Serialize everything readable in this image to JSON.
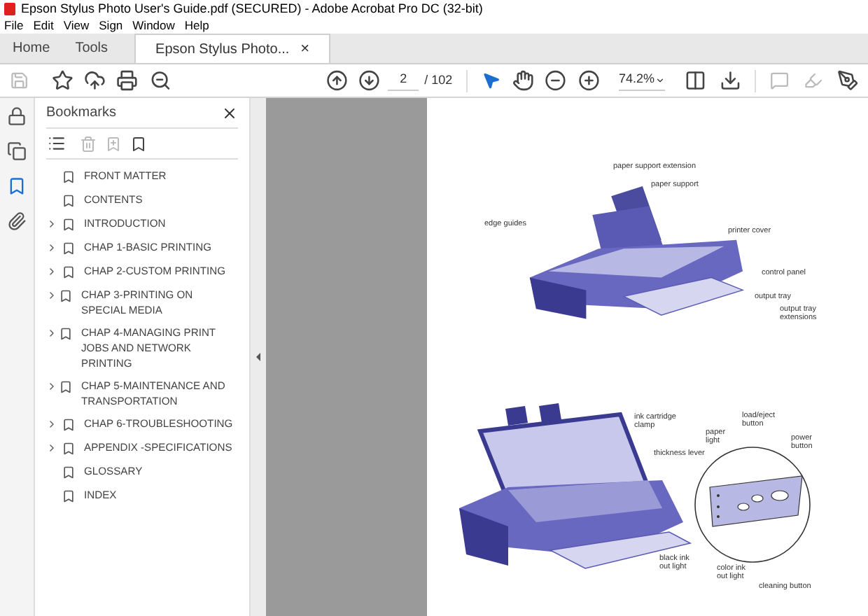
{
  "window": {
    "title": "Epson Stylus Photo User's Guide.pdf (SECURED) - Adobe Acrobat Pro DC (32-bit)"
  },
  "menu": [
    "File",
    "Edit",
    "View",
    "Sign",
    "Window",
    "Help"
  ],
  "tabs": [
    {
      "label": "Home",
      "selected": false,
      "closable": false
    },
    {
      "label": "Tools",
      "selected": false,
      "closable": false
    },
    {
      "label": "Epson Stylus Photo...",
      "selected": true,
      "closable": true
    }
  ],
  "close_glyph": "×",
  "toolbar": {
    "page": "2",
    "page_count": "/ 102",
    "zoom": "74.2%"
  },
  "rail": [
    {
      "kind": "lock",
      "selected": false
    },
    {
      "kind": "pages",
      "selected": false
    },
    {
      "kind": "bookmark",
      "selected": true
    },
    {
      "kind": "clip",
      "selected": false
    }
  ],
  "bookmarks": {
    "title": "Bookmarks",
    "items": [
      {
        "label": "FRONT MATTER",
        "expandable": false
      },
      {
        "label": "CONTENTS",
        "expandable": false
      },
      {
        "label": "INTRODUCTION",
        "expandable": true
      },
      {
        "label": "CHAP 1-BASIC PRINTING",
        "expandable": true
      },
      {
        "label": "CHAP 2-CUSTOM PRINTING",
        "expandable": true
      },
      {
        "label": "CHAP 3-PRINTING ON SPECIAL MEDIA",
        "expandable": true
      },
      {
        "label": "CHAP 4-MANAGING PRINT JOBS AND NETWORK PRINTING",
        "expandable": true
      },
      {
        "label": "CHAP 5-MAINTENANCE AND TRANSPORTATION",
        "expandable": true
      },
      {
        "label": "CHAP 6-TROUBLESHOOTING",
        "expandable": true
      },
      {
        "label": "APPENDIX -SPECIFICATIONS",
        "expandable": true
      },
      {
        "label": "GLOSSARY",
        "expandable": false
      },
      {
        "label": "INDEX",
        "expandable": false
      }
    ]
  },
  "page": {
    "figure_1_labels": [
      "paper support extension",
      "paper support",
      "edge guides",
      "printer cover",
      "control panel",
      "output tray",
      "output tray extensions"
    ],
    "figure_2_labels": [
      "ink cartridge clamp",
      "paper light",
      "load/eject button",
      "power button",
      "thickness lever",
      "black ink out light",
      "color ink out light",
      "cleaning button"
    ]
  }
}
